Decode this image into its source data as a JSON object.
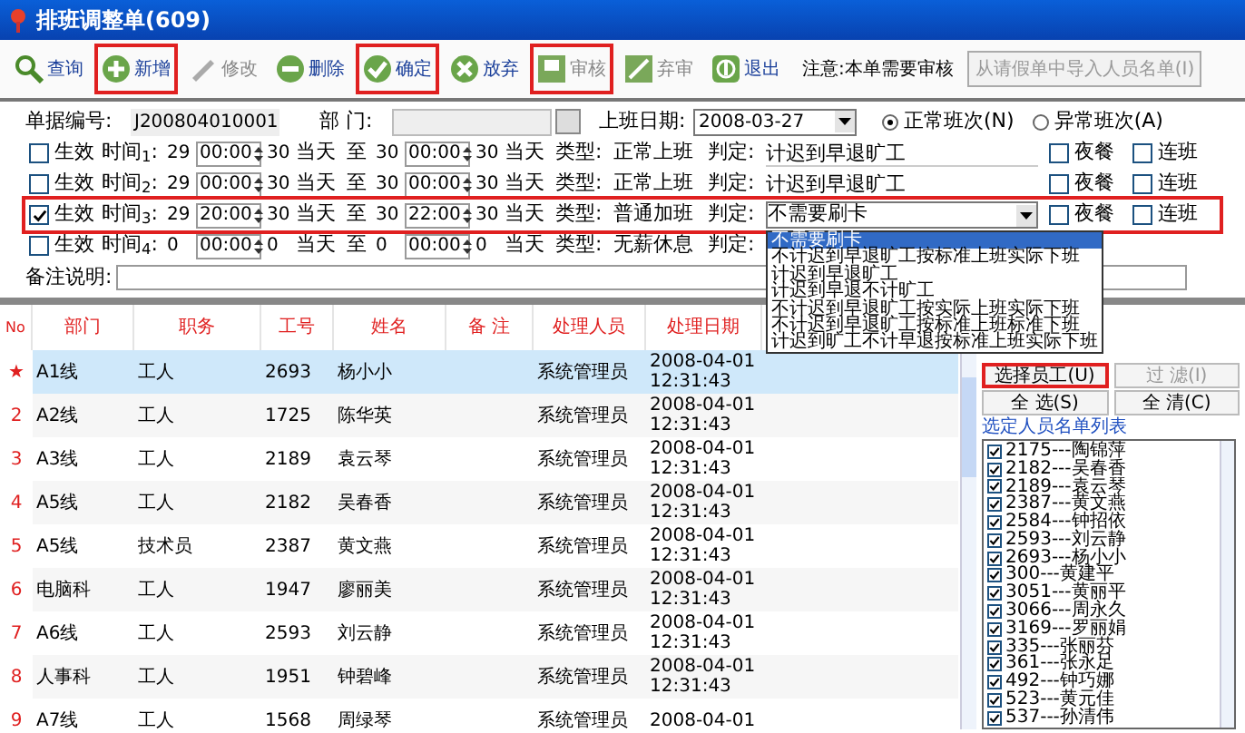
{
  "window": {
    "title": "排班调整单(609)"
  },
  "toolbar": [
    {
      "label": "查询",
      "kind": "search",
      "disabled": false,
      "highlighted": false
    },
    {
      "label": "新增",
      "kind": "add",
      "disabled": false,
      "highlighted": true
    },
    {
      "label": "修改",
      "kind": "edit",
      "disabled": true,
      "highlighted": false
    },
    {
      "label": "删除",
      "kind": "delete",
      "disabled": false,
      "highlighted": false
    },
    {
      "label": "确定",
      "kind": "confirm",
      "disabled": false,
      "highlighted": true
    },
    {
      "label": "放弃",
      "kind": "cancel",
      "disabled": false,
      "highlighted": false
    },
    {
      "label": "审核",
      "kind": "approve",
      "disabled": true,
      "highlighted": true
    },
    {
      "label": "弃审",
      "kind": "unapprove",
      "disabled": true,
      "highlighted": false
    },
    {
      "label": "退出",
      "kind": "exit",
      "disabled": false,
      "highlighted": false
    }
  ],
  "notice": "注意:本单需要审核",
  "import_button": {
    "label": "从请假单中导入人员名单(I)",
    "disabled": true
  },
  "form": {
    "doc_no_label": "单据编号:",
    "doc_no": "J200804010001",
    "dept_label": "部 门:",
    "date_label": "上班日期:",
    "date": "2008-03-27",
    "shift_options": [
      {
        "label": "正常班次(N)",
        "selected": true
      },
      {
        "label": "异常班次(A)",
        "selected": false
      }
    ],
    "time_rows": [
      {
        "checked": false,
        "effective": "生效",
        "label": "时间$_{1}$:",
        "start_day": "29",
        "start_time": "00:00",
        "start_day2": "30",
        "start_rel": "当天",
        "to": "至",
        "end_day": "30",
        "end_time": "00:00",
        "end_day2": "30",
        "end_rel": "当天",
        "type_label": "类型:",
        "type": "正常上班",
        "judge_label": "判定:",
        "judge": "计迟到早退旷工",
        "dropdown": false,
        "highlighted": false,
        "meal": {
          "label": "夜餐",
          "checked": false
        },
        "cont": {
          "label": "连班",
          "checked": false
        }
      },
      {
        "checked": false,
        "effective": "生效",
        "label": "时间$_{2}$:",
        "start_day": "29",
        "start_time": "00:00",
        "start_day2": "30",
        "start_rel": "当天",
        "to": "至",
        "end_day": "30",
        "end_time": "00:00",
        "end_day2": "30",
        "end_rel": "当天",
        "type_label": "类型:",
        "type": "正常上班",
        "judge_label": "判定:",
        "judge": "计迟到早退旷工",
        "dropdown": false,
        "highlighted": false,
        "meal": {
          "label": "夜餐",
          "checked": false
        },
        "cont": {
          "label": "连班",
          "checked": false
        }
      },
      {
        "checked": true,
        "effective": "生效",
        "label": "时间$_{3}$:",
        "start_day": "29",
        "start_time": "20:00",
        "start_day2": "30",
        "start_rel": "当天",
        "to": "至",
        "end_day": "30",
        "end_time": "22:00",
        "end_day2": "30",
        "end_rel": "当天",
        "type_label": "类型:",
        "type": "普通加班",
        "judge_label": "判定:",
        "judge": "不需要刷卡",
        "dropdown": true,
        "highlighted": true,
        "meal": {
          "label": "夜餐",
          "checked": false
        },
        "cont": {
          "label": "连班",
          "checked": false
        }
      },
      {
        "checked": false,
        "effective": "生效",
        "label": "时间$_{4}$:",
        "start_day": "0",
        "start_time": "00:00",
        "start_day2": "0",
        "start_rel": "当天",
        "to": "至",
        "end_day": "0",
        "end_time": "00:00",
        "end_day2": "0",
        "end_rel": "当天",
        "type_label": "类型:",
        "type": "无薪休息",
        "judge_label": "判定:",
        "highlighted": false
      }
    ],
    "remark_label": "备注说明:"
  },
  "dropdown_list": [
    {
      "label": "不需要刷卡",
      "selected": true
    },
    {
      "label": "不计迟到早退旷工按标准上班实际下班",
      "selected": false
    },
    {
      "label": "计迟到早退旷工",
      "selected": false
    },
    {
      "label": "计迟到早退不计旷工",
      "selected": false
    },
    {
      "label": "不计迟到早退旷工按实际上班实际下班",
      "selected": false
    },
    {
      "label": "不计迟到早退旷工按标准上班标准下班",
      "selected": false
    },
    {
      "label": "计迟到旷工不计早退按标准上班实际下班",
      "selected": false
    }
  ],
  "table": {
    "columns": [
      "No",
      "部门",
      "职务",
      "工号",
      "姓名",
      "备 注",
      "处理人员",
      "处理日期"
    ],
    "rows": [
      {
        "selected": true,
        "cells": [
          "★",
          "A1线",
          "工人",
          "2693",
          "杨小小",
          "",
          "系统管理员",
          "2008-04-01 12:31:43"
        ]
      },
      {
        "selected": false,
        "cells": [
          "2",
          "A2线",
          "工人",
          "1725",
          "陈华英",
          "",
          "系统管理员",
          "2008-04-01 12:31:43"
        ]
      },
      {
        "selected": false,
        "cells": [
          "3",
          "A3线",
          "工人",
          "2189",
          "袁云琴",
          "",
          "系统管理员",
          "2008-04-01 12:31:43"
        ]
      },
      {
        "selected": false,
        "cells": [
          "4",
          "A5线",
          "工人",
          "2182",
          "吴春香",
          "",
          "系统管理员",
          "2008-04-01 12:31:43"
        ]
      },
      {
        "selected": false,
        "cells": [
          "5",
          "A5线",
          "技术员",
          "2387",
          "黄文燕",
          "",
          "系统管理员",
          "2008-04-01 12:31:43"
        ]
      },
      {
        "selected": false,
        "cells": [
          "6",
          "电脑科",
          "工人",
          "1947",
          "廖丽美",
          "",
          "系统管理员",
          "2008-04-01 12:31:43"
        ]
      },
      {
        "selected": false,
        "cells": [
          "7",
          "A6线",
          "工人",
          "2593",
          "刘云静",
          "",
          "系统管理员",
          "2008-04-01 12:31:43"
        ]
      },
      {
        "selected": false,
        "cells": [
          "8",
          "人事科",
          "工人",
          "1951",
          "钟碧峰",
          "",
          "系统管理员",
          "2008-04-01 12:31:43"
        ]
      },
      {
        "selected": false,
        "cells": [
          "9",
          "A7线",
          "工人",
          "1568",
          "周绿琴",
          "",
          "系统管理员",
          "2008-04-01"
        ]
      }
    ]
  },
  "side_panel": {
    "buttons": [
      {
        "label": "选择员工(U)",
        "disabled": false,
        "highlighted": true
      },
      {
        "label": "过 滤(I)",
        "disabled": true,
        "highlighted": false
      },
      {
        "label": "全 选(S)",
        "disabled": false,
        "highlighted": false
      },
      {
        "label": "全 清(C)",
        "disabled": false,
        "highlighted": false
      }
    ],
    "list_title": "选定人员名单列表",
    "people": [
      {
        "label": "2175---陶锦萍",
        "checked": true
      },
      {
        "label": "2182---吴春香",
        "checked": true
      },
      {
        "label": "2189---袁云琴",
        "checked": true
      },
      {
        "label": "2387---黄文燕",
        "checked": true
      },
      {
        "label": "2584---钟招依",
        "checked": true
      },
      {
        "label": "2593---刘云静",
        "checked": true
      },
      {
        "label": "2693---杨小小",
        "checked": true
      },
      {
        "label": "300---黄建平",
        "checked": true
      },
      {
        "label": "3051---黄丽平",
        "checked": true
      },
      {
        "label": "3066---周永久",
        "checked": true
      },
      {
        "label": "3169---罗丽娟",
        "checked": true
      },
      {
        "label": "335---张丽芬",
        "checked": true
      },
      {
        "label": "361---张永足",
        "checked": true
      },
      {
        "label": "492---钟巧娜",
        "checked": true
      },
      {
        "label": "523---黄元佳",
        "checked": true
      },
      {
        "label": "537---孙清伟",
        "checked": true
      }
    ]
  }
}
